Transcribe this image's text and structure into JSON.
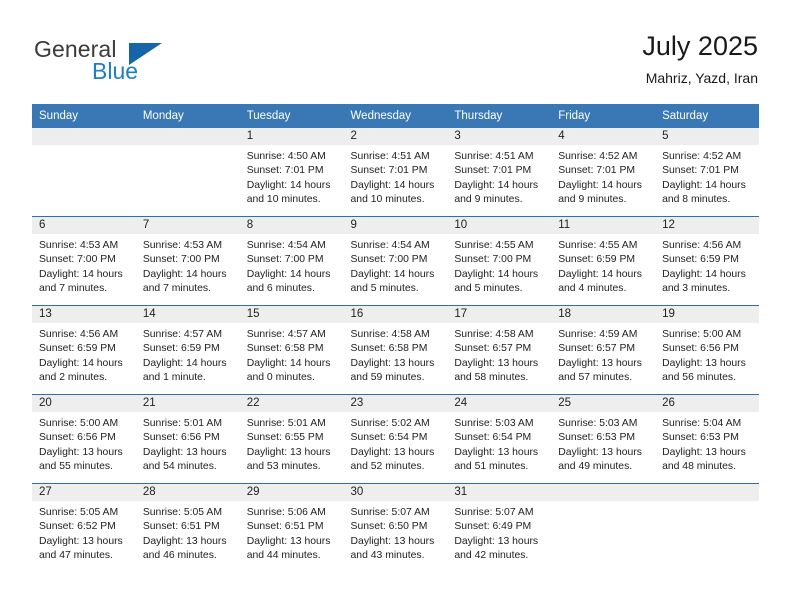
{
  "brand": {
    "name_part1": "General",
    "name_part2": "Blue",
    "logo_icon": "triangle-icon",
    "color_primary": "#1565a8",
    "color_blue_text": "#1f7fc4"
  },
  "header": {
    "title": "July 2025",
    "subtitle": "Mahriz, Yazd, Iran"
  },
  "calendar": {
    "header_background": "#3a78b5",
    "daynum_background": "#eeeeee",
    "row_separator_color": "#2f6fae",
    "weekday_headers": [
      "Sunday",
      "Monday",
      "Tuesday",
      "Wednesday",
      "Thursday",
      "Friday",
      "Saturday"
    ],
    "weeks": [
      [
        {
          "day": "",
          "lines": []
        },
        {
          "day": "",
          "lines": []
        },
        {
          "day": "1",
          "lines": [
            "Sunrise: 4:50 AM",
            "Sunset: 7:01 PM",
            "Daylight: 14 hours",
            "and 10 minutes."
          ]
        },
        {
          "day": "2",
          "lines": [
            "Sunrise: 4:51 AM",
            "Sunset: 7:01 PM",
            "Daylight: 14 hours",
            "and 10 minutes."
          ]
        },
        {
          "day": "3",
          "lines": [
            "Sunrise: 4:51 AM",
            "Sunset: 7:01 PM",
            "Daylight: 14 hours",
            "and 9 minutes."
          ]
        },
        {
          "day": "4",
          "lines": [
            "Sunrise: 4:52 AM",
            "Sunset: 7:01 PM",
            "Daylight: 14 hours",
            "and 9 minutes."
          ]
        },
        {
          "day": "5",
          "lines": [
            "Sunrise: 4:52 AM",
            "Sunset: 7:01 PM",
            "Daylight: 14 hours",
            "and 8 minutes."
          ]
        }
      ],
      [
        {
          "day": "6",
          "lines": [
            "Sunrise: 4:53 AM",
            "Sunset: 7:00 PM",
            "Daylight: 14 hours",
            "and 7 minutes."
          ]
        },
        {
          "day": "7",
          "lines": [
            "Sunrise: 4:53 AM",
            "Sunset: 7:00 PM",
            "Daylight: 14 hours",
            "and 7 minutes."
          ]
        },
        {
          "day": "8",
          "lines": [
            "Sunrise: 4:54 AM",
            "Sunset: 7:00 PM",
            "Daylight: 14 hours",
            "and 6 minutes."
          ]
        },
        {
          "day": "9",
          "lines": [
            "Sunrise: 4:54 AM",
            "Sunset: 7:00 PM",
            "Daylight: 14 hours",
            "and 5 minutes."
          ]
        },
        {
          "day": "10",
          "lines": [
            "Sunrise: 4:55 AM",
            "Sunset: 7:00 PM",
            "Daylight: 14 hours",
            "and 5 minutes."
          ]
        },
        {
          "day": "11",
          "lines": [
            "Sunrise: 4:55 AM",
            "Sunset: 6:59 PM",
            "Daylight: 14 hours",
            "and 4 minutes."
          ]
        },
        {
          "day": "12",
          "lines": [
            "Sunrise: 4:56 AM",
            "Sunset: 6:59 PM",
            "Daylight: 14 hours",
            "and 3 minutes."
          ]
        }
      ],
      [
        {
          "day": "13",
          "lines": [
            "Sunrise: 4:56 AM",
            "Sunset: 6:59 PM",
            "Daylight: 14 hours",
            "and 2 minutes."
          ]
        },
        {
          "day": "14",
          "lines": [
            "Sunrise: 4:57 AM",
            "Sunset: 6:59 PM",
            "Daylight: 14 hours",
            "and 1 minute."
          ]
        },
        {
          "day": "15",
          "lines": [
            "Sunrise: 4:57 AM",
            "Sunset: 6:58 PM",
            "Daylight: 14 hours",
            "and 0 minutes."
          ]
        },
        {
          "day": "16",
          "lines": [
            "Sunrise: 4:58 AM",
            "Sunset: 6:58 PM",
            "Daylight: 13 hours",
            "and 59 minutes."
          ]
        },
        {
          "day": "17",
          "lines": [
            "Sunrise: 4:58 AM",
            "Sunset: 6:57 PM",
            "Daylight: 13 hours",
            "and 58 minutes."
          ]
        },
        {
          "day": "18",
          "lines": [
            "Sunrise: 4:59 AM",
            "Sunset: 6:57 PM",
            "Daylight: 13 hours",
            "and 57 minutes."
          ]
        },
        {
          "day": "19",
          "lines": [
            "Sunrise: 5:00 AM",
            "Sunset: 6:56 PM",
            "Daylight: 13 hours",
            "and 56 minutes."
          ]
        }
      ],
      [
        {
          "day": "20",
          "lines": [
            "Sunrise: 5:00 AM",
            "Sunset: 6:56 PM",
            "Daylight: 13 hours",
            "and 55 minutes."
          ]
        },
        {
          "day": "21",
          "lines": [
            "Sunrise: 5:01 AM",
            "Sunset: 6:56 PM",
            "Daylight: 13 hours",
            "and 54 minutes."
          ]
        },
        {
          "day": "22",
          "lines": [
            "Sunrise: 5:01 AM",
            "Sunset: 6:55 PM",
            "Daylight: 13 hours",
            "and 53 minutes."
          ]
        },
        {
          "day": "23",
          "lines": [
            "Sunrise: 5:02 AM",
            "Sunset: 6:54 PM",
            "Daylight: 13 hours",
            "and 52 minutes."
          ]
        },
        {
          "day": "24",
          "lines": [
            "Sunrise: 5:03 AM",
            "Sunset: 6:54 PM",
            "Daylight: 13 hours",
            "and 51 minutes."
          ]
        },
        {
          "day": "25",
          "lines": [
            "Sunrise: 5:03 AM",
            "Sunset: 6:53 PM",
            "Daylight: 13 hours",
            "and 49 minutes."
          ]
        },
        {
          "day": "26",
          "lines": [
            "Sunrise: 5:04 AM",
            "Sunset: 6:53 PM",
            "Daylight: 13 hours",
            "and 48 minutes."
          ]
        }
      ],
      [
        {
          "day": "27",
          "lines": [
            "Sunrise: 5:05 AM",
            "Sunset: 6:52 PM",
            "Daylight: 13 hours",
            "and 47 minutes."
          ]
        },
        {
          "day": "28",
          "lines": [
            "Sunrise: 5:05 AM",
            "Sunset: 6:51 PM",
            "Daylight: 13 hours",
            "and 46 minutes."
          ]
        },
        {
          "day": "29",
          "lines": [
            "Sunrise: 5:06 AM",
            "Sunset: 6:51 PM",
            "Daylight: 13 hours",
            "and 44 minutes."
          ]
        },
        {
          "day": "30",
          "lines": [
            "Sunrise: 5:07 AM",
            "Sunset: 6:50 PM",
            "Daylight: 13 hours",
            "and 43 minutes."
          ]
        },
        {
          "day": "31",
          "lines": [
            "Sunrise: 5:07 AM",
            "Sunset: 6:49 PM",
            "Daylight: 13 hours",
            "and 42 minutes."
          ]
        },
        {
          "day": "",
          "lines": []
        },
        {
          "day": "",
          "lines": []
        }
      ]
    ]
  }
}
